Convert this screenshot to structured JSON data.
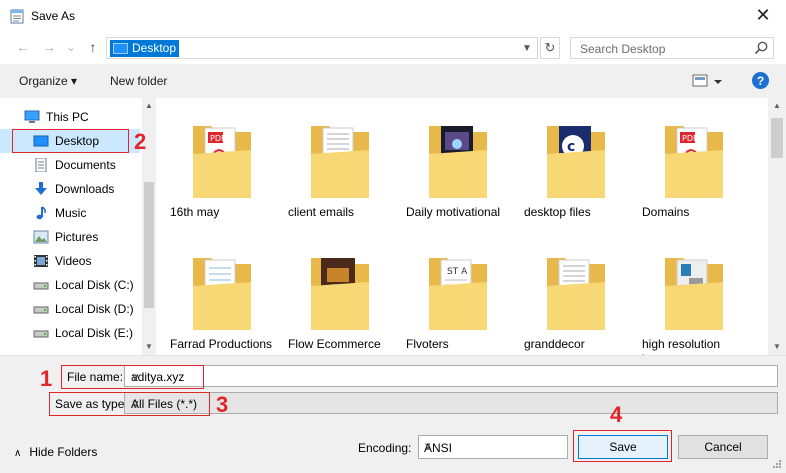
{
  "window": {
    "title": "Save As",
    "close_glyph": "✕"
  },
  "nav": {
    "back_glyph": "←",
    "forward_glyph": "→",
    "recent_glyph": "⌄",
    "up_glyph": "↑",
    "address_value": "Desktop",
    "refresh_glyph": "↻",
    "search_placeholder": "Search Desktop"
  },
  "toolbar": {
    "organize_label": "Organize ▾",
    "new_folder_label": "New folder",
    "help_label": "?"
  },
  "sidebar": {
    "items": [
      {
        "label": "This PC",
        "icon": "pc-icon"
      },
      {
        "label": "Desktop",
        "icon": "desktop-icon",
        "selected": true
      },
      {
        "label": "Documents",
        "icon": "documents-icon"
      },
      {
        "label": "Downloads",
        "icon": "downloads-icon"
      },
      {
        "label": "Music",
        "icon": "music-icon"
      },
      {
        "label": "Pictures",
        "icon": "pictures-icon"
      },
      {
        "label": "Videos",
        "icon": "videos-icon"
      },
      {
        "label": "Local Disk (C:)",
        "icon": "disk-icon"
      },
      {
        "label": "Local Disk (D:)",
        "icon": "disk-icon"
      },
      {
        "label": "Local Disk (E:)",
        "icon": "disk-icon"
      }
    ]
  },
  "files": [
    {
      "name": "16th may",
      "preview": "pdf"
    },
    {
      "name": "client emails",
      "preview": "doc"
    },
    {
      "name": "Daily motivational",
      "preview": "dark"
    },
    {
      "name": "desktop files",
      "preview": "cpanel"
    },
    {
      "name": "Domains",
      "preview": "pdf"
    },
    {
      "name": "Farrad Productions",
      "preview": "sheet"
    },
    {
      "name": "Flow Ecommerce",
      "preview": "photo"
    },
    {
      "name": "Flvoters",
      "preview": "text"
    },
    {
      "name": "granddecor",
      "preview": "doc"
    },
    {
      "name": "high resolution image",
      "preview": "grey"
    }
  ],
  "form": {
    "filename_label": "File name:",
    "filename_value": "aditya.xyz",
    "filetype_label": "Save as type:",
    "filetype_value": "All Files  (*.*)"
  },
  "footer": {
    "hide_folders_label": "Hide Folders",
    "encoding_label": "Encoding:",
    "encoding_value": "ANSI",
    "save_label": "Save",
    "cancel_label": "Cancel"
  },
  "annotations": {
    "n1": "1",
    "n2": "2",
    "n3": "3",
    "n4": "4"
  },
  "colors": {
    "accent": "#0078d7",
    "selection": "#cce8ff",
    "annotation_red": "#e0262c",
    "folder": "#f8d775"
  }
}
